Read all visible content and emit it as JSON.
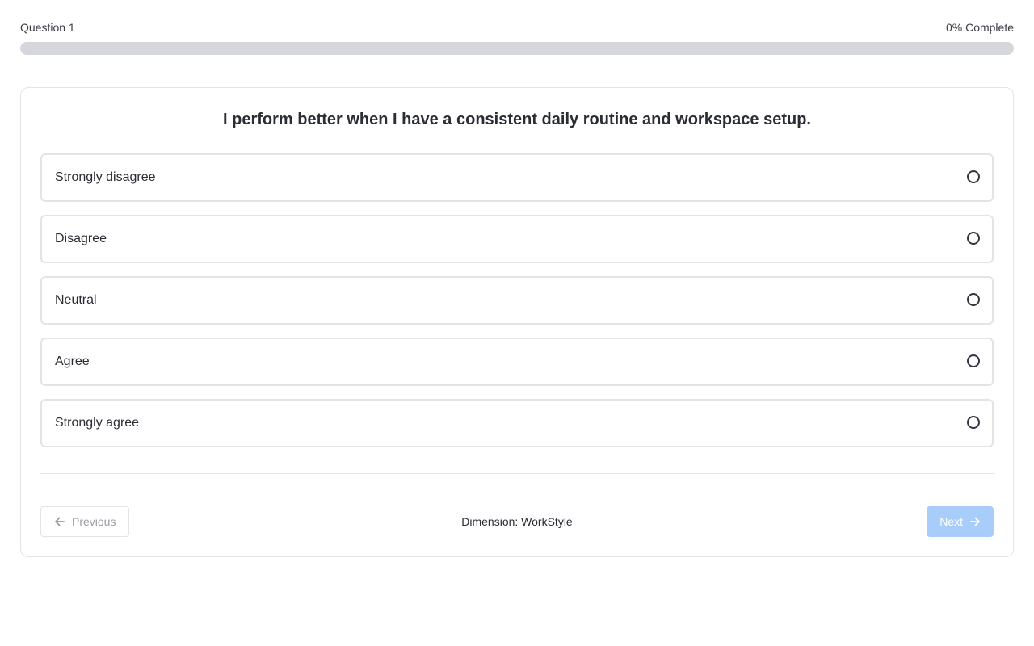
{
  "progress": {
    "question_label": "Question 1",
    "complete_label": "0% Complete",
    "fraction": 0
  },
  "question": {
    "text": "I perform better when I have a consistent daily routine and workspace setup."
  },
  "options": [
    {
      "label": "Strongly disagree"
    },
    {
      "label": "Disagree"
    },
    {
      "label": "Neutral"
    },
    {
      "label": "Agree"
    },
    {
      "label": "Strongly agree"
    }
  ],
  "footer": {
    "previous_label": "Previous",
    "dimension_label": "Dimension: WorkStyle",
    "next_label": "Next",
    "previous_icon": "arrow-left-icon",
    "next_icon": "arrow-right-icon"
  },
  "colors": {
    "accent": "#60a5fa",
    "next_disabled_bg": "#a9cdfb",
    "track": "#d6d7dc"
  }
}
